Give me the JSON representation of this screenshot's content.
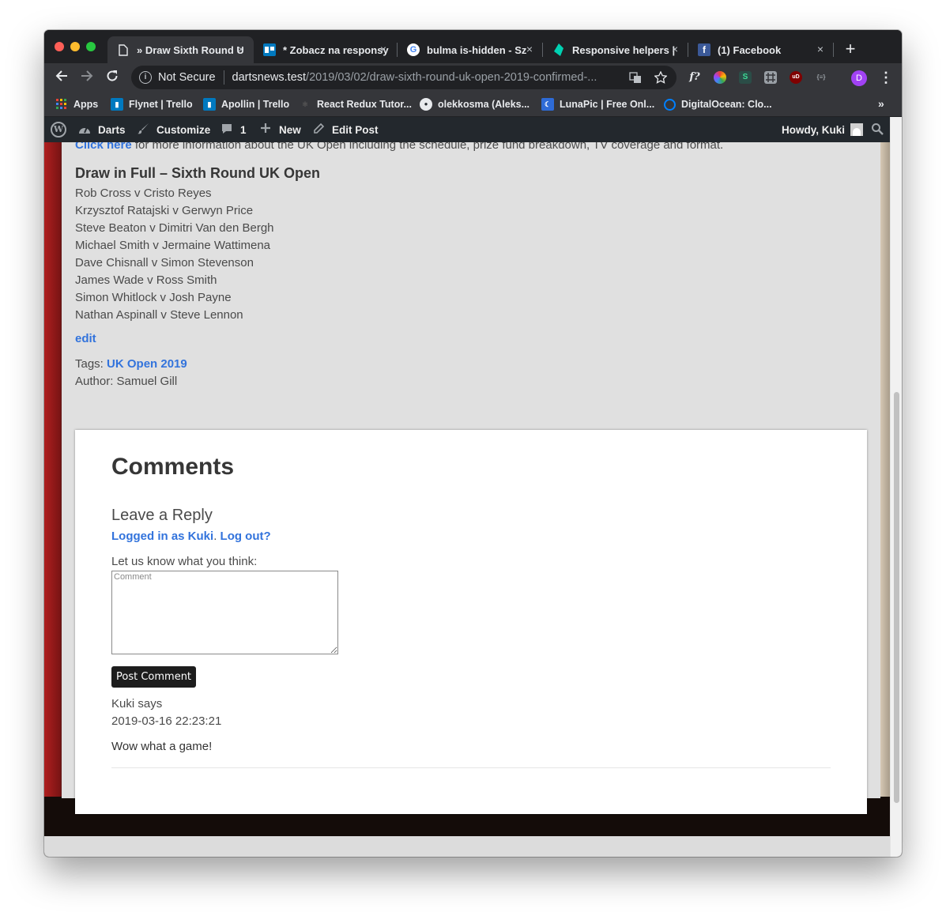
{
  "browser": {
    "tabs": [
      {
        "title": "» Draw Sixth Round U",
        "icon": "page-icon",
        "active": true
      },
      {
        "title": "* Zobacz na responsy",
        "icon": "trello-icon",
        "active": false
      },
      {
        "title": "bulma is-hidden - Sz",
        "icon": "google-icon",
        "active": false
      },
      {
        "title": "Responsive helpers |",
        "icon": "bulma-icon",
        "active": false
      },
      {
        "title": "(1) Facebook",
        "icon": "facebook-icon",
        "active": false
      }
    ],
    "new_tab": "+",
    "close_glyph": "×",
    "address": {
      "security": "Not Secure",
      "host": "dartsnews.test",
      "path": "/2019/03/02/draw-sixth-round-uk-open-2019-confirmed-..."
    },
    "extensions": {
      "script_label": "f?",
      "s_label": "S",
      "ub_label": "uD",
      "json_label": "{≡}"
    },
    "profile_initial": "D",
    "bookmarks": [
      {
        "label": "Apps",
        "icon": "apps-grid-icon"
      },
      {
        "label": "Flynet | Trello",
        "icon": "trello-icon"
      },
      {
        "label": "Apollin | Trello",
        "icon": "trello-icon"
      },
      {
        "label": "React Redux Tutor...",
        "icon": "react-icon"
      },
      {
        "label": "olekkosma (Aleks...",
        "icon": "github-icon"
      },
      {
        "label": "LunaPic | Free Onl...",
        "icon": "lunapic-icon"
      },
      {
        "label": "DigitalOcean: Clo...",
        "icon": "digitalocean-icon"
      }
    ],
    "bookmarks_more": "»"
  },
  "adminbar": {
    "site": "Darts",
    "customize": "Customize",
    "comments_count": "1",
    "new": "New",
    "edit_post": "Edit Post",
    "howdy": "Howdy, Kuki"
  },
  "article": {
    "intro_link": "Click here",
    "intro_rest": " for more information about the UK Open including the schedule, prize fund breakdown, TV coverage and format.",
    "draw_title": "Draw in Full – Sixth Round UK Open",
    "matches": [
      "Rob Cross v Cristo Reyes",
      "Krzysztof Ratajski v Gerwyn Price",
      "Steve Beaton v Dimitri Van den Bergh",
      "Michael Smith v Jermaine Wattimena",
      "Dave Chisnall v Simon Stevenson",
      "James Wade v Ross Smith",
      "Simon Whitlock v Josh Payne",
      "Nathan Aspinall v Steve Lennon"
    ],
    "edit": "edit",
    "tags_label": "Tags: ",
    "tag": "UK Open 2019",
    "author": "Author: Samuel Gill"
  },
  "comments": {
    "title": "Comments",
    "leave_reply": "Leave a Reply",
    "logged_in": "Logged in as Kuki",
    "period": ". ",
    "logout": "Log out?",
    "prompt": "Let us know what you think:",
    "placeholder": "Comment",
    "submit": "Post Comment",
    "entry": {
      "author": "Kuki says",
      "date": "2019-03-16 22:23:21",
      "text": "Wow what a game!"
    }
  }
}
